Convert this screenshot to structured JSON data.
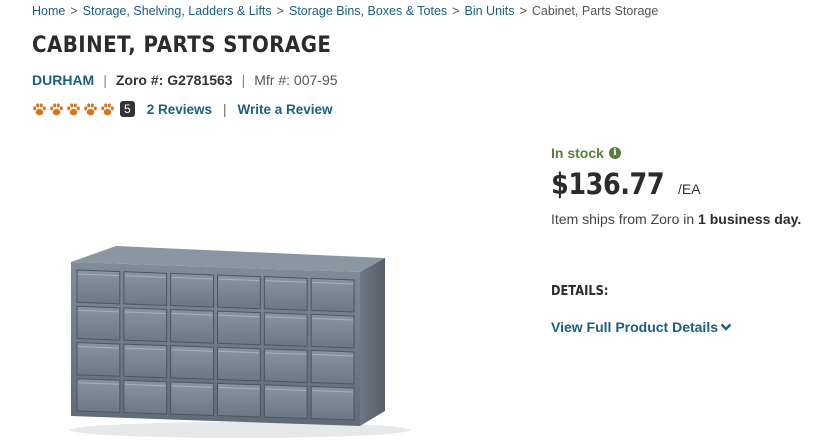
{
  "breadcrumb": {
    "items": [
      "Home",
      "Storage, Shelving, Ladders & Lifts",
      "Storage Bins, Boxes & Totes",
      "Bin Units"
    ],
    "current": "Cabinet, Parts Storage",
    "separator": ">"
  },
  "product": {
    "title": "CABINET, PARTS STORAGE",
    "brand": "DURHAM",
    "zoro_label": "Zoro #:",
    "zoro_number": "G2781563",
    "mfr_label": "Mfr #:",
    "mfr_number": "007-95",
    "divider": "|"
  },
  "rating": {
    "stars": 5,
    "max_stars": 5,
    "score_badge": "5",
    "reviews_link": "2 Reviews",
    "divider": "|",
    "write_review": "Write a Review",
    "star_color": "#d9741c"
  },
  "purchase": {
    "stock_status": "In stock",
    "stock_icon": "info-icon",
    "price": "$136.77",
    "unit": "/EA",
    "ships_prefix": "Item ships from Zoro in",
    "ships_bold": "1 business day."
  },
  "details": {
    "heading": "DETAILS:",
    "link": "View Full Product Details",
    "link_icon": "chevron-down-icon"
  },
  "colors": {
    "link": "#1b5e80",
    "stock_green": "#5a7d3a",
    "cabinet_gray": "#6f7d8c"
  }
}
